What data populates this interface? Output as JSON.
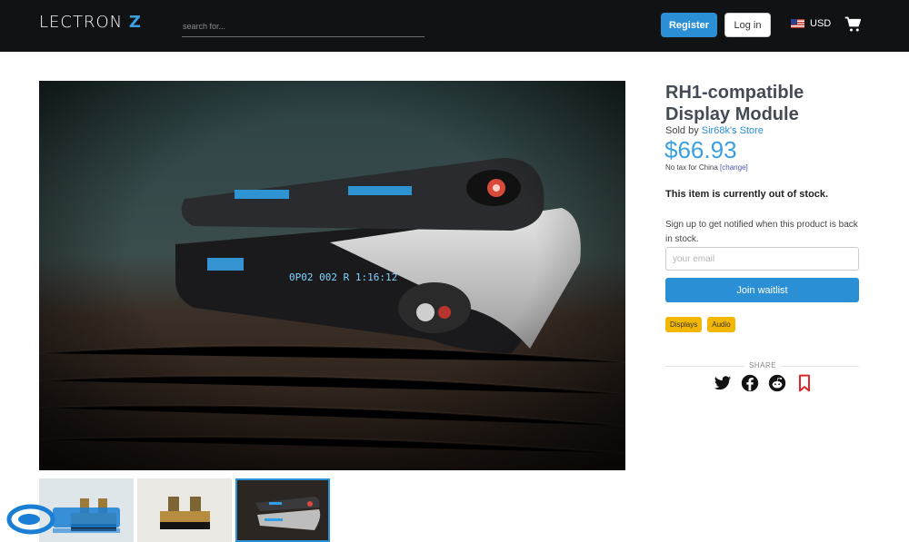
{
  "header": {
    "logo_text": "LECTRON",
    "logo_accent": "Z",
    "search_placeholder": "search for...",
    "register_label": "Register",
    "login_label": "Log in",
    "currency": "USD",
    "cart_icon": "cart-icon",
    "flag_icon": "us-flag-icon"
  },
  "product": {
    "title": "RH1-compatible Display Module",
    "sold_by_prefix": "Sold by",
    "store_name": "Sir68k's Store",
    "price": "$66.93",
    "tax_text": "No tax for China",
    "tax_change": "[change]",
    "stock_status": "This item is currently out of stock.",
    "signup_text": "Sign up to get notified when this product is back in stock.",
    "email_placeholder": "your email",
    "waitlist_label": "Join waitlist",
    "tags": [
      "Displays",
      "Audio"
    ]
  },
  "share": {
    "label": "SHARE",
    "icons": [
      "twitter-icon",
      "facebook-icon",
      "reddit-icon",
      "bookmark-icon"
    ]
  },
  "colors": {
    "accent": "#2b8fd6",
    "price": "#3aa0e0",
    "tag": "#f2b705",
    "header_bg": "#111214"
  }
}
